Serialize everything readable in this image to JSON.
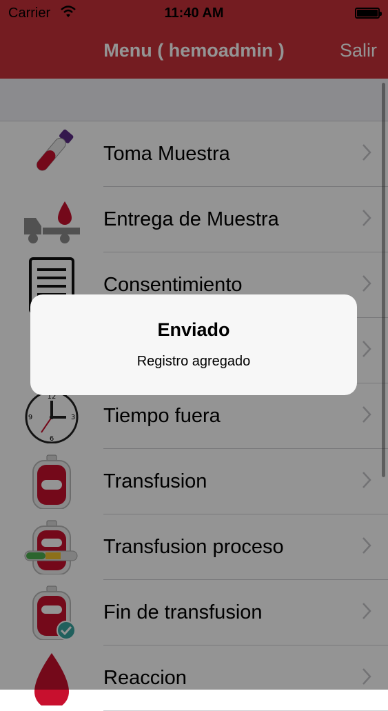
{
  "status_bar": {
    "carrier": "Carrier",
    "time": "11:40 AM"
  },
  "nav": {
    "title": "Menu ( hemoadmin )",
    "right_button": "Salir"
  },
  "menu": [
    {
      "label": "Toma Muestra",
      "icon": "blood-tube-icon"
    },
    {
      "label": "Entrega de Muestra",
      "icon": "delivery-truck-icon"
    },
    {
      "label": "Consentimiento",
      "icon": "document-icon"
    },
    {
      "label": "",
      "icon": "hidden-item-icon"
    },
    {
      "label": "Tiempo fuera",
      "icon": "clock-icon"
    },
    {
      "label": "Transfusion",
      "icon": "blood-bag-icon"
    },
    {
      "label": "Transfusion proceso",
      "icon": "blood-bag-progress-icon"
    },
    {
      "label": "Fin de transfusion",
      "icon": "blood-bag-check-icon"
    },
    {
      "label": "Reaccion",
      "icon": "blood-drop-icon"
    }
  ],
  "alert": {
    "title": "Enviado",
    "message": "Registro agregado"
  },
  "colors": {
    "nav_bg": "#c9313a",
    "accent_red": "#b5121b",
    "check_teal": "#3aa6a0"
  }
}
